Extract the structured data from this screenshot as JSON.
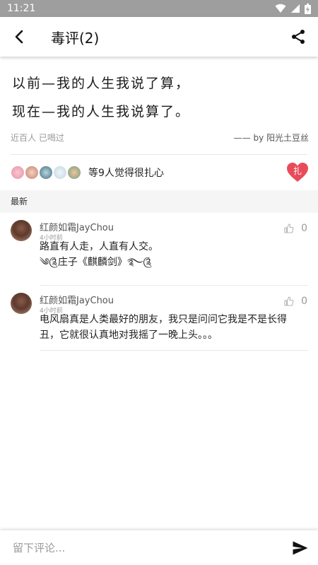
{
  "status_bar": {
    "time": "11:21"
  },
  "header": {
    "title": "毒评(2)"
  },
  "post": {
    "lines": [
      "以前—我的人生我说了算，",
      "现在—我的人生我说算了。"
    ],
    "views": "近百人 已喝过",
    "author": "—— by 阳光土豆丝"
  },
  "likes": {
    "text": "等9人觉得很扎心",
    "heart_label": "扎",
    "heart_color": "#e84c5b"
  },
  "section": {
    "label": "最新"
  },
  "comments": [
    {
      "name": "红颜如霜JayChou",
      "time": "4小时前",
      "lines": [
        "路直有人走，人直有人交。",
        "༄༊庄子《麒麟剑》࿐༊"
      ],
      "likes": "0"
    },
    {
      "name": "红颜如霜JayChou",
      "time": "4小时前",
      "lines": [
        "电风扇真是人类最好的朋友，我只是问问它我是不是长得",
        "丑，它就很认真地对我摇了一晚上头。。。"
      ],
      "likes": "0"
    }
  ],
  "input": {
    "placeholder": "留下评论...",
    "value": ""
  }
}
